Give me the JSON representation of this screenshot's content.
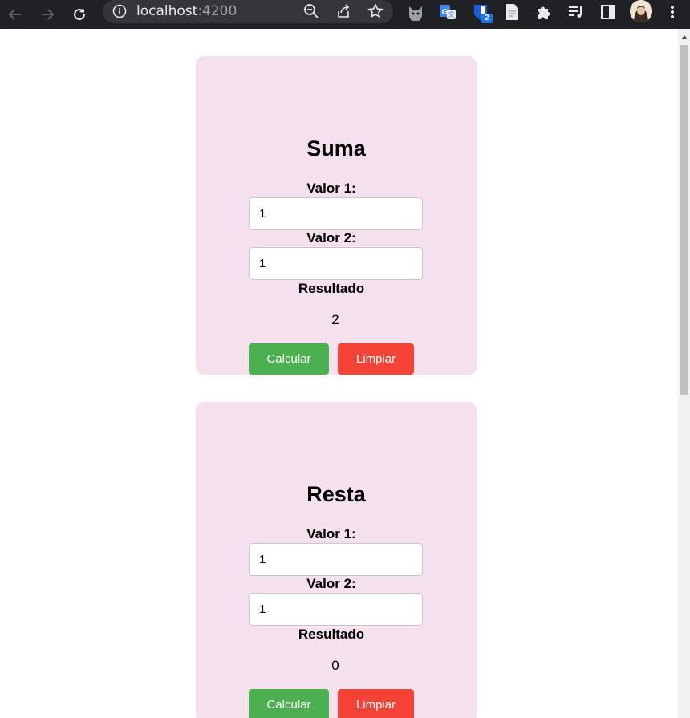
{
  "browser": {
    "url_host": "localhost",
    "url_port": ":4200",
    "extension_badge": "2",
    "icons": [
      "back-icon",
      "forward-icon",
      "reload-icon",
      "info-icon",
      "zoom-out-icon",
      "share-icon",
      "bookmark-star-icon",
      "cat-extension-icon",
      "translate-extension-icon",
      "bitwarden-extension-icon",
      "document-extension-icon",
      "extensions-puzzle-icon",
      "media-queue-icon",
      "side-panel-icon",
      "menu-kebab-icon"
    ]
  },
  "colors": {
    "card_background": "#f5e0ee",
    "calcular_button": "#4caf50",
    "limpiar_button": "#f44336",
    "chrome_dark": "#202124"
  },
  "suma": {
    "title": "Suma",
    "valor1_label": "Valor 1:",
    "valor1_value": "1",
    "valor2_label": "Valor 2:",
    "valor2_value": "1",
    "result_label": "Resultado",
    "result_value": "2",
    "calcular_label": "Calcular",
    "limpiar_label": "Limpiar"
  },
  "resta": {
    "title": "Resta",
    "valor1_label": "Valor 1:",
    "valor1_value": "1",
    "valor2_label": "Valor 2:",
    "valor2_value": "1",
    "result_label": "Resultado",
    "result_value": "0",
    "calcular_label": "Calcular",
    "limpiar_label": "Limpiar"
  }
}
